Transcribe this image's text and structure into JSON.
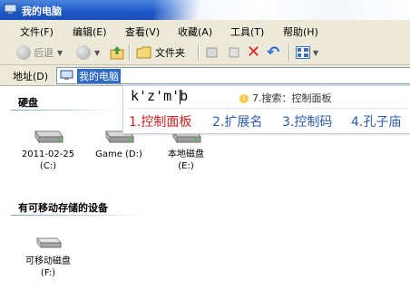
{
  "window": {
    "title": "我的电脑"
  },
  "menu": [
    "文件(F)",
    "编辑(E)",
    "查看(V)",
    "收藏(A)",
    "工具(T)",
    "帮助(H)"
  ],
  "toolbar": {
    "back_label": "后退",
    "folders_label": "文件夹"
  },
  "address": {
    "label": "地址(D)",
    "value": "我的电脑"
  },
  "groups": {
    "hard_disks": {
      "title": "硬盘",
      "drives": [
        {
          "name": "2011-02-25",
          "letter": "(C:)"
        },
        {
          "name": "Game (D:)",
          "letter": ""
        },
        {
          "name": "本地磁盘",
          "letter": "(E:)"
        }
      ]
    },
    "removable": {
      "title": "有可移动存储的设备",
      "drives": [
        {
          "name": "可移动磁盘",
          "letter": "(F:)"
        }
      ]
    }
  },
  "ime": {
    "composition": "k'z'm'b",
    "search_hint": "7.搜索：控制面板",
    "candidates": [
      "1.控制面板",
      "2.扩展名",
      "3.控制码",
      "4.孔子庙"
    ]
  },
  "colors": {
    "selected_candidate": "#d11f1f",
    "candidate": "#2a5db0",
    "address_highlight": "#316ac5"
  }
}
